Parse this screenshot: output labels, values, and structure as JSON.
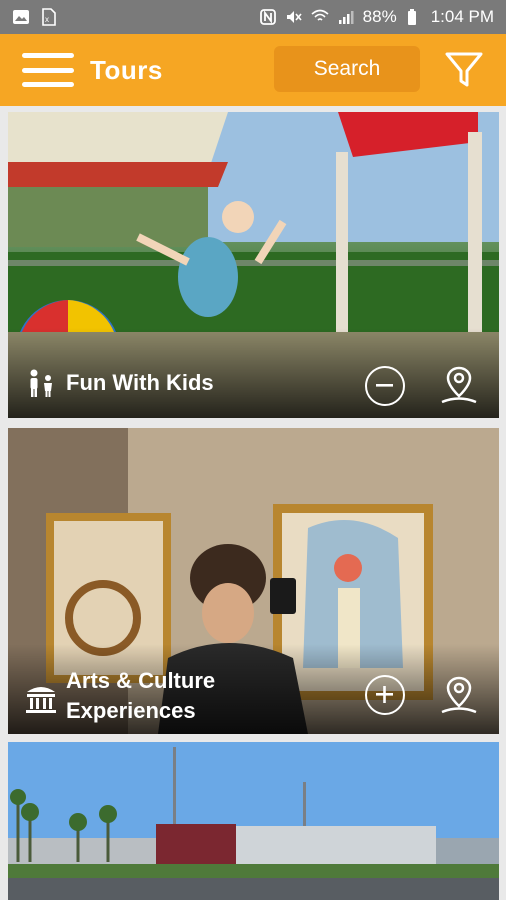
{
  "status_bar": {
    "battery": "88%",
    "time": "1:04 PM"
  },
  "app_bar": {
    "title": "Tours",
    "search_label": "Search"
  },
  "cards": [
    {
      "label_line1": "Fun With Kids",
      "label_line2": "",
      "action": "remove"
    },
    {
      "label_line1": "Arts & Culture",
      "label_line2": "Experiences",
      "action": "add"
    },
    {
      "label_line1": "",
      "label_line2": "",
      "action": ""
    }
  ],
  "colors": {
    "accent": "#f6a623",
    "search_bg": "#e8931b",
    "status_bar": "#7a7a7a"
  }
}
